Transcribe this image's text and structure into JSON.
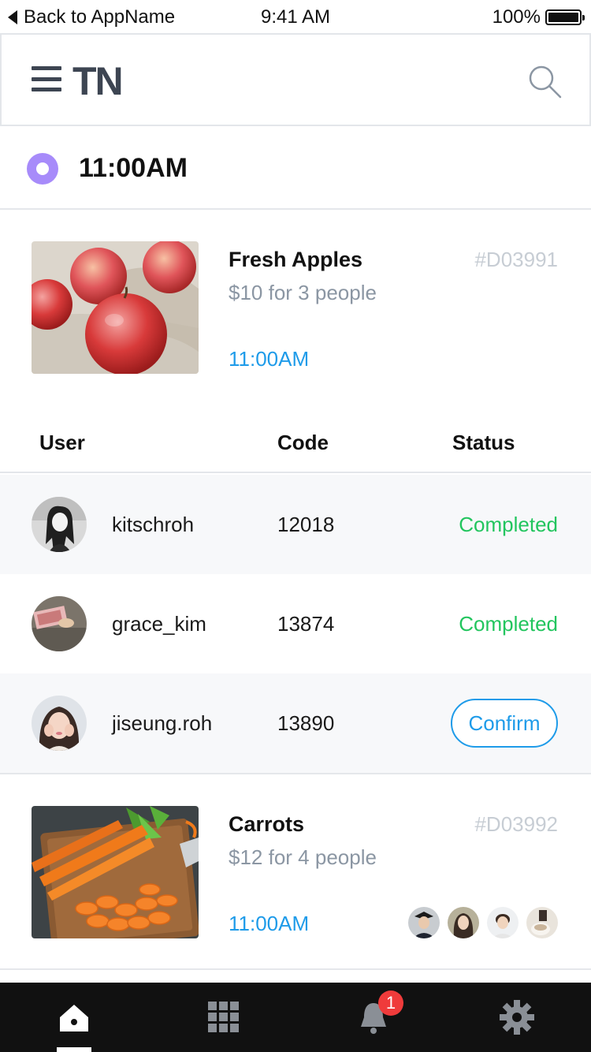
{
  "status_bar": {
    "back_label": "Back to AppName",
    "time": "9:41 AM",
    "battery": "100%"
  },
  "nav": {
    "logo": "TN"
  },
  "section": {
    "time": "11:00AM"
  },
  "products": [
    {
      "name": "Fresh Apples",
      "price": "$10 for 3 people",
      "code": "#D03991",
      "time": "11:00AM"
    },
    {
      "name": "Carrots",
      "price": "$12 for 4 people",
      "code": "#D03992",
      "time": "11:00AM"
    }
  ],
  "table": {
    "headers": [
      "User",
      "Code",
      "Status"
    ],
    "rows": [
      {
        "user": "kitschroh",
        "code": "12018",
        "status": "Completed"
      },
      {
        "user": "grace_kim",
        "code": "13874",
        "status": "Completed"
      },
      {
        "user": "jiseung.roh",
        "code": "13890",
        "status": "Confirm"
      }
    ]
  },
  "tabbar": {
    "notification_count": "1",
    "tabs": [
      "home-icon",
      "grid-icon",
      "bell-icon",
      "gear-icon"
    ]
  },
  "colors": {
    "accent_blue": "#1e9be9",
    "completed_green": "#22c55e",
    "dot_purple": "#a78bfa",
    "badge_red": "#ef3b3b"
  }
}
